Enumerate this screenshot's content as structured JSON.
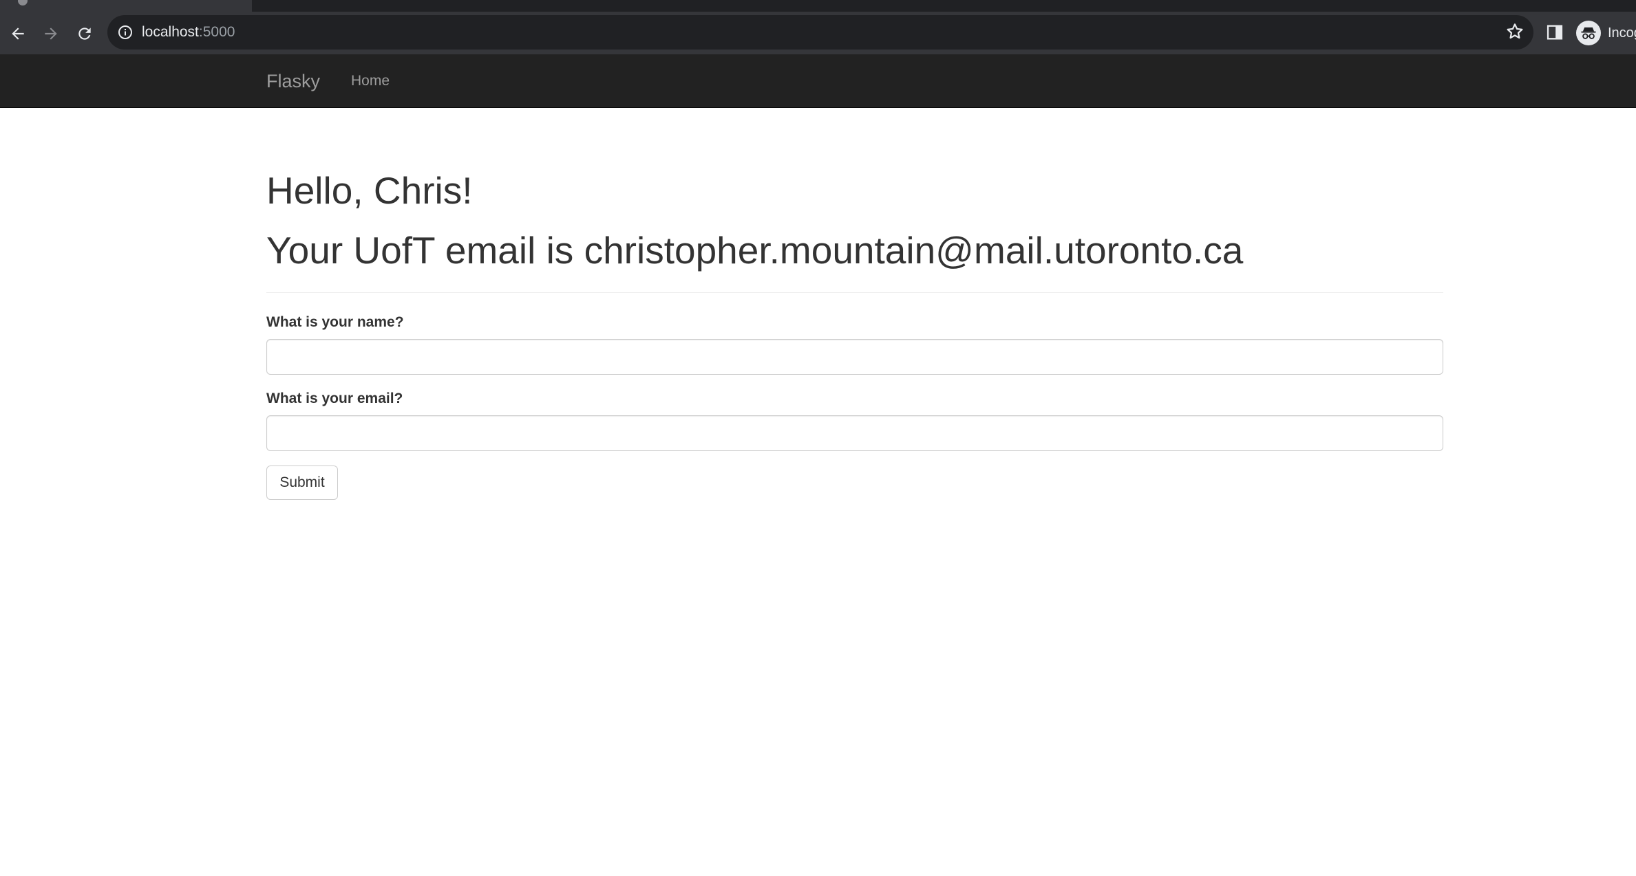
{
  "browser": {
    "url_host": "localhost",
    "url_port": ":5000",
    "profile_label": "Incog"
  },
  "navbar": {
    "brand": "Flasky",
    "home": "Home"
  },
  "page": {
    "greeting": "Hello, Chris!",
    "email_line": "Your UofT email is christopher.mountain@mail.utoronto.ca"
  },
  "form": {
    "name_label": "What is your name?",
    "name_value": "",
    "email_label": "What is your email?",
    "email_value": "",
    "submit_label": "Submit"
  },
  "colors": {
    "chrome_dark": "#35363a",
    "omnibox": "#202124",
    "navbar": "#222222",
    "navbar_text": "#9d9d9d",
    "body_text": "#333333"
  }
}
